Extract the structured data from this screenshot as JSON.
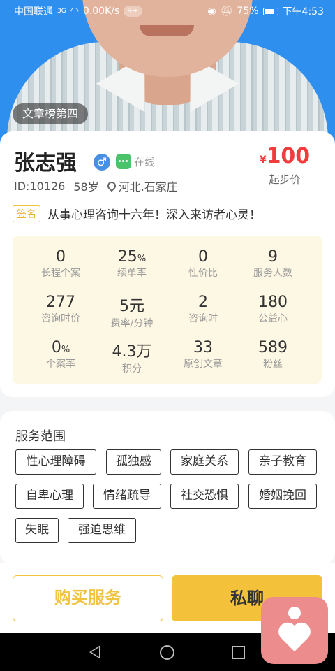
{
  "status_bar": {
    "carrier": "中国联通",
    "network": "3G",
    "speed": "0.00K/s",
    "notif_badge": "9+",
    "battery": "75%",
    "time": "下午4:53"
  },
  "hero": {
    "rank_badge": "文章榜第四"
  },
  "profile": {
    "name": "张志强",
    "gender_symbol": "♂",
    "online": "在线",
    "id": "ID:10126",
    "age": "58岁",
    "location": "河北.石家庄",
    "price_currency": "¥",
    "price_value": "100",
    "price_label": "起步价",
    "sign_tag": "签名",
    "sign_text": "从事心理咨询十六年！深入来访者心灵！"
  },
  "stats": [
    {
      "value": "0",
      "unit": "",
      "label": "长程个案"
    },
    {
      "value": "25",
      "unit": "%",
      "label": "续单率"
    },
    {
      "value": "0",
      "unit": "",
      "label": "性价比"
    },
    {
      "value": "9",
      "unit": "",
      "label": "服务人数"
    },
    {
      "value": "277",
      "unit": "",
      "label": "咨询时价"
    },
    {
      "value": "5元",
      "unit": "",
      "label": "费率/分钟"
    },
    {
      "value": "2",
      "unit": "",
      "label": "咨询时"
    },
    {
      "value": "180",
      "unit": "",
      "label": "公益心"
    },
    {
      "value": "0",
      "unit": "%",
      "label": "个案率"
    },
    {
      "value": "4.3万",
      "unit": "",
      "label": "积分"
    },
    {
      "value": "33",
      "unit": "",
      "label": "原创文章"
    },
    {
      "value": "589",
      "unit": "",
      "label": "粉丝"
    }
  ],
  "services": {
    "title": "服务范围",
    "tags": [
      "性心理障碍",
      "孤独感",
      "家庭关系",
      "亲子教育",
      "自卑心理",
      "情绪疏导",
      "社交恐惧",
      "婚姻挽回",
      "失眠",
      "强迫思维"
    ]
  },
  "actions": {
    "buy": "购买服务",
    "chat": "私聊"
  },
  "colors": {
    "accent": "#f3c13a",
    "price": "#f03c3c",
    "hero_bg": "#2f8fee",
    "stats_bg": "#fdf8e4"
  }
}
